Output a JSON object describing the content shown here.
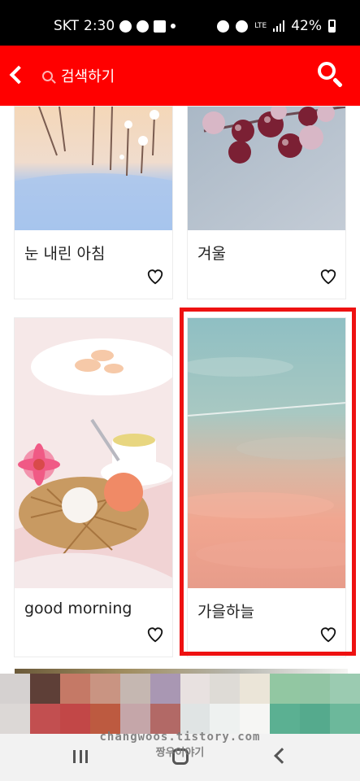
{
  "status_bar": {
    "carrier": "SKT",
    "time": "2:30",
    "network": "LTE",
    "battery": "42%"
  },
  "app_bar": {
    "search_placeholder": "검색하기"
  },
  "cards": [
    {
      "title": "눈 내린 아침"
    },
    {
      "title": "겨울"
    },
    {
      "title": "good morning"
    },
    {
      "title": "가을하늘",
      "highlighted": true
    }
  ],
  "watermark": {
    "line1": "changwoos.tistory.com",
    "line2": "짱우이야기"
  },
  "icons": {
    "back": "back-icon",
    "search": "search-icon",
    "heart": "heart-icon"
  },
  "colors": {
    "app_bar": "#ff0000",
    "highlight_border": "#ee1111"
  }
}
